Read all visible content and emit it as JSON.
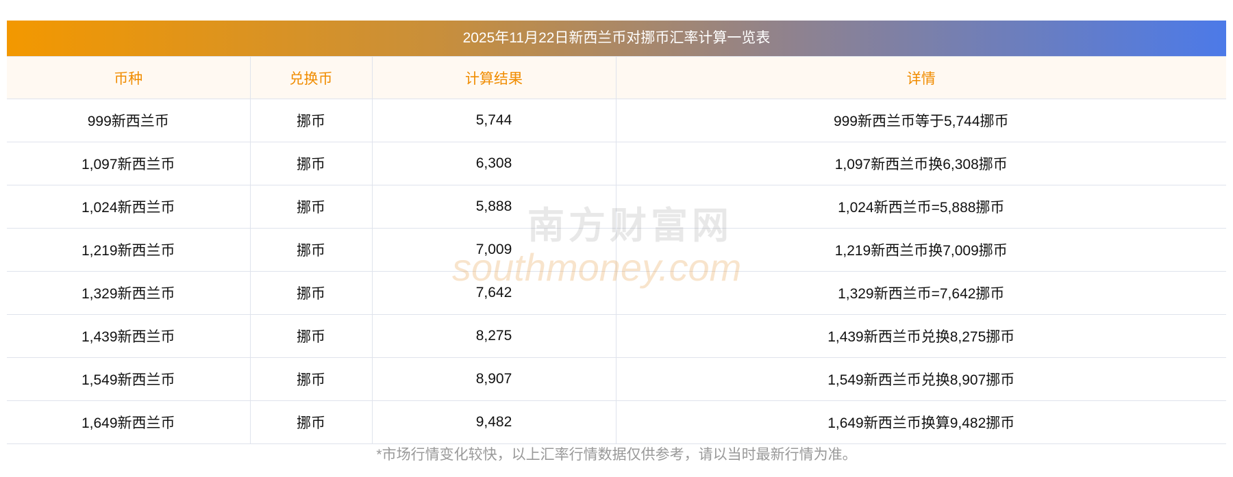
{
  "title": "2025年11月22日新西兰币对挪币汇率计算一览表",
  "headers": [
    "币种",
    "兑换币",
    "计算结果",
    "详情"
  ],
  "rows": [
    [
      "999新西兰币",
      "挪币",
      "5,744",
      "999新西兰币等于5,744挪币"
    ],
    [
      "1,097新西兰币",
      "挪币",
      "6,308",
      "1,097新西兰币换6,308挪币"
    ],
    [
      "1,024新西兰币",
      "挪币",
      "5,888",
      "1,024新西兰币=5,888挪币"
    ],
    [
      "1,219新西兰币",
      "挪币",
      "7,009",
      "1,219新西兰币换7,009挪币"
    ],
    [
      "1,329新西兰币",
      "挪币",
      "7,642",
      "1,329新西兰币=7,642挪币"
    ],
    [
      "1,439新西兰币",
      "挪币",
      "8,275",
      "1,439新西兰币兑换8,275挪币"
    ],
    [
      "1,549新西兰币",
      "挪币",
      "8,907",
      "1,549新西兰币兑换8,907挪币"
    ],
    [
      "1,649新西兰币",
      "挪币",
      "9,482",
      "1,649新西兰币换算9,482挪币"
    ]
  ],
  "note": "*市场行情变化较快，以上汇率行情数据仅供参考，请以当时最新行情为准。",
  "watermark": {
    "cn": "南方财富网",
    "en": "southmoney.com"
  }
}
